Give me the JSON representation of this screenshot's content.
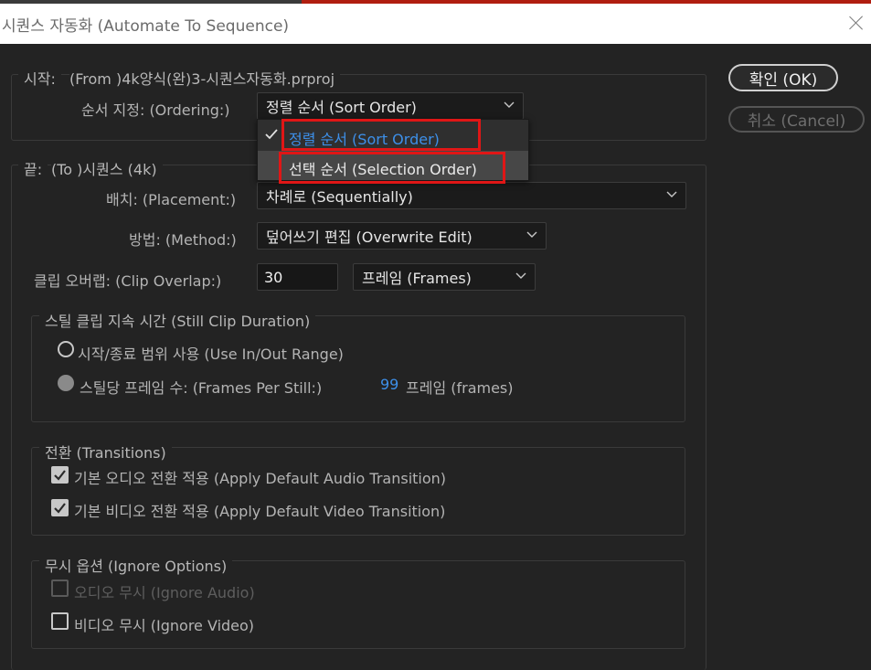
{
  "window": {
    "title": "시퀀스 자동화 (Automate To Sequence)"
  },
  "from": {
    "label": "시작:",
    "value": "(From )4k양식(완)3-시퀀스자동화.prproj",
    "ordering_label": "순서 지정: (Ordering:)",
    "ordering_value": "정렬 순서 (Sort Order)",
    "ordering_options": [
      "정렬 순서 (Sort Order)",
      "선택 순서 (Selection Order)"
    ]
  },
  "to": {
    "label": "끝:",
    "value": "(To )시퀀스 (4k)",
    "placement_label": "배치: (Placement:)",
    "placement_value": "차례로 (Sequentially)",
    "method_label": "방법: (Method:)",
    "method_value": "덮어쓰기 편집 (Overwrite Edit)",
    "clip_overlap_label": "클립 오버랩: (Clip Overlap:)",
    "clip_overlap_value": "30",
    "clip_overlap_unit": "프레임 (Frames)"
  },
  "still_clip": {
    "title": "스틸 클립 지속 시간 (Still Clip Duration)",
    "use_in_out": "시작/종료 범위 사용 (Use In/Out Range)",
    "frames_per_still_label": "스틸당 프레임 수: (Frames Per Still:)",
    "frames_per_still_value": "99",
    "frames_unit": "프레임 (frames)"
  },
  "transitions": {
    "title": "전환 (Transitions)",
    "audio": "기본 오디오 전환 적용 (Apply Default Audio Transition)",
    "video": "기본 비디오 전환 적용 (Apply Default Video Transition)"
  },
  "ignore": {
    "title": "무시 옵션 (Ignore Options)",
    "audio": "오디오 무시 (Ignore Audio)",
    "video": "비디오 무시 (Ignore Video)"
  },
  "buttons": {
    "ok": "확인 (OK)",
    "cancel": "취소 (Cancel)"
  },
  "colors": {
    "accent": "#3d8fe8",
    "highlight": "#e01616",
    "background": "#232323"
  },
  "icons": [
    "close-icon",
    "chevron-down-icon",
    "checkmark-icon",
    "radio-icon",
    "checkbox-icon"
  ]
}
